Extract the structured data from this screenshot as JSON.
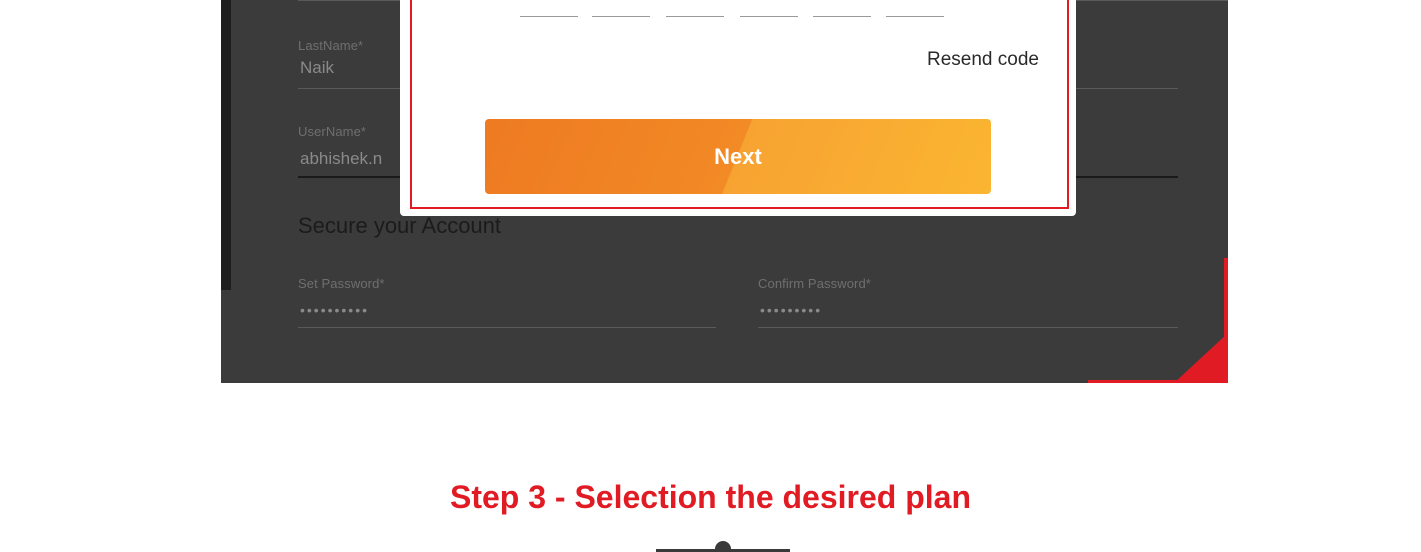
{
  "form": {
    "last_name": {
      "label": "LastName*",
      "value": "Naik"
    },
    "user_name": {
      "label": "UserName*",
      "value": "abhishek.n"
    },
    "section_title": "Secure your Account",
    "set_password": {
      "label": "Set Password*",
      "value": "••••••••••"
    },
    "confirm_password": {
      "label": "Confirm Password*",
      "value": "•••••••••"
    }
  },
  "modal": {
    "resend_label": "Resend code",
    "next_label": "Next"
  },
  "caption": {
    "step_title": "Step 3  - Selection the desired plan"
  },
  "colors": {
    "brand_red": "#e11b24",
    "button_orange_dark": "#ee7a22",
    "button_orange_light": "#fbb531",
    "form_background": "#3a3b3a"
  }
}
